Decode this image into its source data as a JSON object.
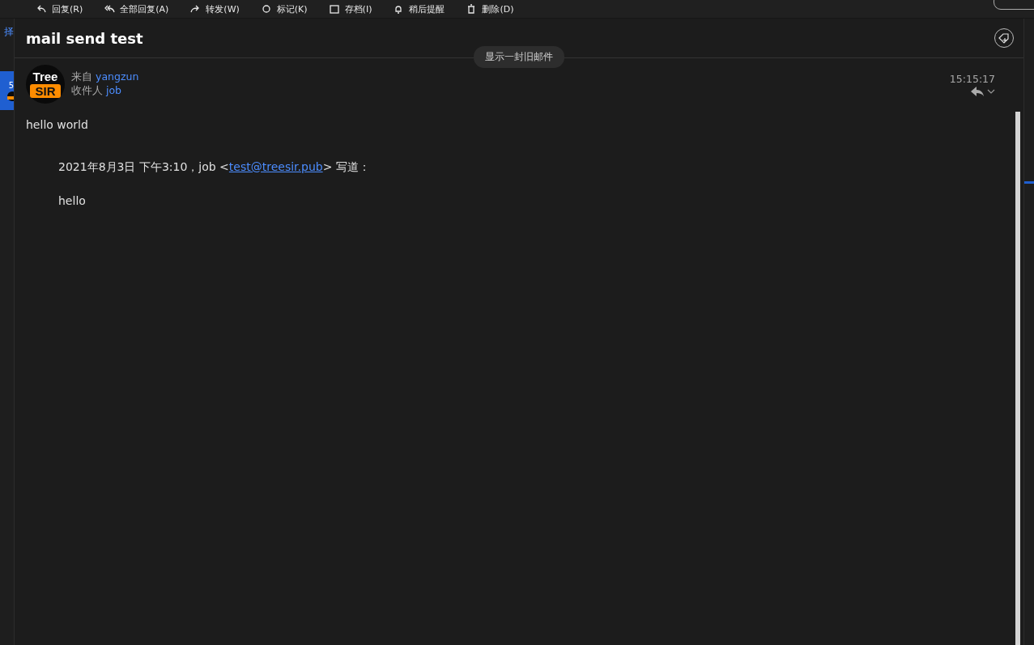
{
  "toolbar": {
    "items": [
      {
        "label": "回复(R)",
        "kind": "reply"
      },
      {
        "label": "全部回复(A)",
        "kind": "reply_all"
      },
      {
        "label": "转发(W)",
        "kind": "forward"
      },
      {
        "label": "标记(K)",
        "kind": "flag"
      },
      {
        "label": "存档(I)",
        "kind": "archive"
      },
      {
        "label": "稍后提醒",
        "kind": "snooze"
      },
      {
        "label": "删除(D)",
        "kind": "delete"
      }
    ]
  },
  "sidebar": {
    "edge_label": "择",
    "selected_item": {
      "count": "5",
      "selected": true
    }
  },
  "message": {
    "subject": "mail send test",
    "older_pill": "显示一封旧邮件",
    "avatar": {
      "top": "Tree",
      "bottom": "SIR"
    },
    "from_label": "来自",
    "from": "yangzun",
    "to_label": "收件人",
    "to": "job",
    "time": "15:15:17",
    "body": "hello world",
    "quote_header": {
      "prefix": "2021年8月3日 下午3:10，job <",
      "email": "test@treesir.pub",
      "suffix": "> 写道："
    },
    "quote_body": "hello"
  }
}
